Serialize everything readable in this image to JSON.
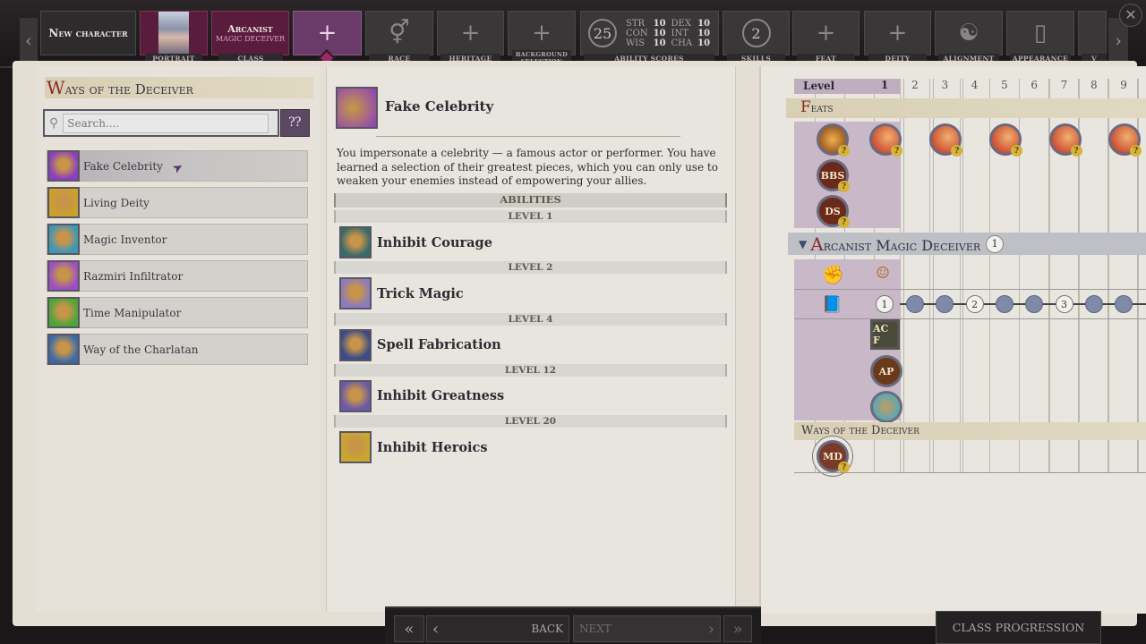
{
  "topbar": {
    "new_character": "New character",
    "tabs": [
      {
        "label": "PORTRAIT",
        "state": "done"
      },
      {
        "label": "CLASS",
        "title": "Arcanist",
        "subtitle": "MAGIC DECEIVER",
        "state": "done"
      },
      {
        "label": "",
        "state": "current",
        "icon": "plus-icon"
      },
      {
        "label": "RACE",
        "icon": "gender-icon"
      },
      {
        "label": "HERITAGE",
        "icon": "plus-icon"
      },
      {
        "label": "BACKGROUND SELECTION",
        "icon": "plus-icon"
      },
      {
        "label": "ABILITY SCORES",
        "points": "25"
      },
      {
        "label": "SKILLS",
        "points": "2"
      },
      {
        "label": "FEAT",
        "icon": "plus-icon"
      },
      {
        "label": "DEITY",
        "icon": "plus-icon"
      },
      {
        "label": "ALIGNMENT",
        "icon": "alignment-icon"
      },
      {
        "label": "APPEARANCE",
        "icon": "mirror-icon"
      },
      {
        "label": "V"
      }
    ],
    "stats": [
      [
        "STR",
        "10"
      ],
      [
        "DEX",
        "10"
      ],
      [
        "CON",
        "10"
      ],
      [
        "INT",
        "10"
      ],
      [
        "WIS",
        "10"
      ],
      [
        "CHA",
        "10"
      ]
    ]
  },
  "left": {
    "header_cap": "W",
    "header_rest": "ays of the Deceiver",
    "search_placeholder": "Search....",
    "items": [
      {
        "label": "Fake Celebrity",
        "color": "#8a3fc0",
        "selected": true
      },
      {
        "label": "Living Deity",
        "color": "#c9a22a"
      },
      {
        "label": "Magic Inventor",
        "color": "#3a98b8"
      },
      {
        "label": "Razmiri Infiltrator",
        "color": "#9b4fc4"
      },
      {
        "label": "Time Manipulator",
        "color": "#4aa63a"
      },
      {
        "label": "Way of the Charlatan",
        "color": "#3a6aa8"
      }
    ]
  },
  "detail": {
    "title": "Fake Celebrity",
    "description": "You impersonate a celebrity — a famous actor or performer. You have learned a selection of their greatest pieces, which you can only use to weaken your enemies instead of empowering your allies.",
    "abilities_label": "ABILITIES",
    "abilities": [
      {
        "level": "LEVEL 1",
        "name": "Inhibit Courage",
        "color": "#3a6a6a"
      },
      {
        "level": "LEVEL 2",
        "name": "Trick Magic",
        "color": "#8a7ac0"
      },
      {
        "level": "LEVEL 4",
        "name": "Spell Fabrication",
        "color": "#3a4a8a"
      },
      {
        "level": "LEVEL 12",
        "name": "Inhibit Greatness",
        "color": "#6a5aa8"
      },
      {
        "level": "LEVEL 20",
        "name": "Inhibit Heroics",
        "color": "#c8a830"
      }
    ]
  },
  "progression": {
    "level_label": "Level",
    "levels": [
      "1",
      "2",
      "3",
      "4",
      "5",
      "6",
      "7",
      "8",
      "9"
    ],
    "feats_cap": "F",
    "feats_rest": "eats",
    "feat_icons": [
      "BBS",
      "DS"
    ],
    "feat_levels": [
      1,
      3,
      5,
      7,
      9
    ],
    "class_cap": "A",
    "class_rest": "rcanist Magic Deceiver",
    "class_level": "1",
    "spell_nodes": [
      "1",
      "",
      "",
      "2",
      "",
      "",
      "3",
      "",
      ""
    ],
    "class_features": [
      "AC F",
      "AP"
    ],
    "ways_label": "Ways of the Deceiver",
    "ways_icon": "MD"
  },
  "bottom": {
    "back": "BACK",
    "next": "NEXT",
    "class_progression": "CLASS PROGRESSION"
  }
}
